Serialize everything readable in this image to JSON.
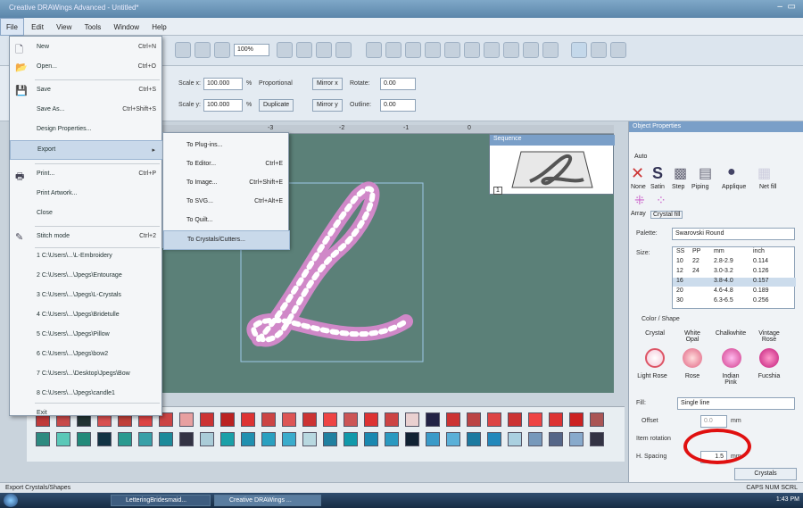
{
  "window": {
    "title": "Creative DRAWings Advanced - Untitled*"
  },
  "menubar": [
    "File",
    "Edit",
    "View",
    "Tools",
    "Window",
    "Help"
  ],
  "file_menu": [
    {
      "label": "New",
      "shortcut": "Ctrl+N",
      "icon": "new-doc-icon"
    },
    {
      "label": "Open...",
      "shortcut": "Ctrl+O",
      "icon": "open-icon"
    },
    {
      "label": "Save",
      "shortcut": "Ctrl+S",
      "icon": "save-icon"
    },
    {
      "label": "Save As...",
      "shortcut": "Ctrl+Shift+S"
    },
    {
      "label": "Design Properties..."
    },
    {
      "label": "Export",
      "shortcut": "▸"
    },
    {
      "label": "Print...",
      "shortcut": "Ctrl+P",
      "icon": "print-icon"
    },
    {
      "label": "Print Artwork..."
    },
    {
      "label": "Close"
    },
    {
      "label": "Stitch mode",
      "shortcut": "Ctrl+2",
      "icon": "stitch-icon"
    },
    {
      "label": "1 C:\\Users\\...\\L-Embroidery"
    },
    {
      "label": "2 C:\\Users\\...\\Jpegs\\Entourage"
    },
    {
      "label": "3 C:\\Users\\...\\Jpegs\\L-Crystals"
    },
    {
      "label": "4 C:\\Users\\...\\Jpegs\\Bridetulle"
    },
    {
      "label": "5 C:\\Users\\...\\Jpegs\\Pillow"
    },
    {
      "label": "6 C:\\Users\\...\\Jpegs\\bow2"
    },
    {
      "label": "7 C:\\Users\\...\\Desktop\\Jpegs\\Bow"
    },
    {
      "label": "8 C:\\Users\\...\\Jpegs\\candle1"
    },
    {
      "label": "Exit"
    }
  ],
  "export_submenu": [
    {
      "label": "To Plug-ins...",
      "shortcut": ""
    },
    {
      "label": "To Editor...",
      "shortcut": "Ctrl+E"
    },
    {
      "label": "To Image...",
      "shortcut": "Ctrl+Shift+E"
    },
    {
      "label": "To SVG...",
      "shortcut": "Ctrl+Alt+E"
    },
    {
      "label": "To Quilt..."
    },
    {
      "label": "To Crystals/Cutters..."
    }
  ],
  "toolbar2": {
    "scale_x_label": "Scale x:",
    "scale_x": "100.000",
    "scale_y_label": "Scale y:",
    "scale_y": "100.000",
    "pct": "%",
    "proportional": "Proportional",
    "duplicate": "Duplicate",
    "mirror_x": "Mirror x",
    "mirror_y": "Mirror y",
    "rotate_label": "Rotate:",
    "rotate": "0.00",
    "outline_label": "Outline:",
    "outline": "0.00",
    "zoom": "100%"
  },
  "ruler_ticks": [
    "-3",
    "-2",
    "-1",
    "0"
  ],
  "sequence": {
    "title": "Sequence",
    "badge": "1"
  },
  "props": {
    "title": "Object Properties",
    "auto": "Auto",
    "types": [
      "None",
      "Satin",
      "Step",
      "Piping",
      "Applique",
      "Net fill"
    ],
    "types2": [
      "Array",
      "Crystal fill"
    ],
    "palette_label": "Palette:",
    "palette_value": "Swarovski Round",
    "size_label": "Size:",
    "size_headers": [
      "SS",
      "PP",
      "mm",
      "inch"
    ],
    "size_rows": [
      [
        "10",
        "22",
        "2.8-2.9",
        "0.114"
      ],
      [
        "12",
        "24",
        "3.0-3.2",
        "0.126"
      ],
      [
        "16",
        "",
        "3.8-4.0",
        "0.157"
      ],
      [
        "20",
        "",
        "4.6-4.8",
        "0.189"
      ],
      [
        "30",
        "",
        "6.3-6.5",
        "0.256"
      ]
    ],
    "color_shape": "Color / Shape",
    "gems_row1": [
      "Crystal",
      "White Opal",
      "Chalkwhite",
      "Vintage Rose"
    ],
    "gems_row2": [
      "Light Rose",
      "Rose",
      "Indian Pink",
      "Fucshia"
    ],
    "fill_label": "Fill:",
    "fill_value": "Single line",
    "offset_label": "Offset",
    "offset_value": "0.0",
    "unit": "mm",
    "item_rotation_label": "Item rotation",
    "h_spacing_label": "H. Spacing",
    "h_spacing_value": "1.5",
    "crystals_btn": "Crystals"
  },
  "status": {
    "text": "Export Crystals/Shapes",
    "right": "CAPS NUM SCRL"
  },
  "taskbar": {
    "items": [
      "LetteringBridesmaid...",
      "Creative DRAWings ..."
    ],
    "clock": "1:43 PM"
  },
  "colors": {
    "canvas": "#5b8078",
    "letter_outline": "#d088c8",
    "highlight": "#e01010"
  },
  "palette_row1": [
    "#c03a3a",
    "#c84a4a",
    "#233",
    "#d85050",
    "#c0403a",
    "#d44",
    "#c44",
    "#e7a0a0",
    "#c33",
    "#b22",
    "#d33",
    "#c44",
    "#d55",
    "#c33",
    "#e44",
    "#c55",
    "#d33",
    "#c44",
    "#e9d0d0",
    "#224",
    "#c33",
    "#b44",
    "#d44",
    "#c33",
    "#e44",
    "#d33",
    "#c22",
    "#a55"
  ],
  "palette_row2": [
    "#2d8a80",
    "#5ac8b8",
    "#228a7a",
    "#134",
    "#2a9a90",
    "#38a0a8",
    "#1c8a9a",
    "#334",
    "#aaccd8",
    "#1aa0a8",
    "#2090b0",
    "#2aa0c0",
    "#3aaccc",
    "#b8d8e0",
    "#2080a0",
    "#19a",
    "#1a88b0",
    "#2a99c0",
    "#123",
    "#3a9ac8",
    "#5ab0d8",
    "#1c7aa0",
    "#2288bb",
    "#aad0e0",
    "#7799bb",
    "#556688",
    "#88aacc",
    "#334"
  ]
}
